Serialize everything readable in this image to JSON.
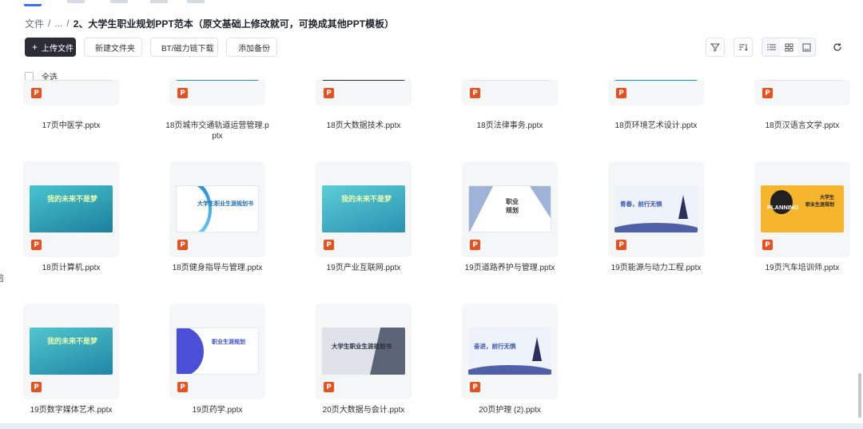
{
  "breadcrumb": {
    "root": "文件",
    "sep1": "/",
    "ellipsis": "...",
    "sep2": "/",
    "current": "2、大学生职业规划PPT范本（原文基础上修改就可，可换成其他PPT模板）"
  },
  "toolbar": {
    "upload": "上传文件",
    "new_folder": "新建文件夹",
    "bt": "BT/磁力链下载",
    "backup": "添加备份"
  },
  "select_all": "全选",
  "left_edge_char": "暗",
  "files": [
    {
      "name": "17页中医学.pptx",
      "badge": "P"
    },
    {
      "name": "18页城市交通轨道运营管理.pptx",
      "badge": "P"
    },
    {
      "name": "18页大数据技术.pptx",
      "badge": "P"
    },
    {
      "name": "18页法律事务.pptx",
      "badge": "P"
    },
    {
      "name": "18页环境艺术设计.pptx",
      "badge": "P"
    },
    {
      "name": "18页汉语言文学.pptx",
      "badge": "P"
    },
    {
      "name": "18页计算机.pptx",
      "badge": "P"
    },
    {
      "name": "18页健身指导与管理.pptx",
      "badge": "P"
    },
    {
      "name": "19页产业互联网.pptx",
      "badge": "P"
    },
    {
      "name": "19页道路养护与管理.pptx",
      "badge": "P"
    },
    {
      "name": "19页能源与动力工程.pptx",
      "badge": "P"
    },
    {
      "name": "19页汽车培训师.pptx",
      "badge": "P"
    },
    {
      "name": "19页数字媒体艺术.pptx",
      "badge": "P"
    },
    {
      "name": "19页药学.pptx",
      "badge": "P"
    },
    {
      "name": "20页大数据与会计.pptx",
      "badge": "P"
    },
    {
      "name": "20页护理 (2).pptx",
      "badge": "P"
    }
  ],
  "thumbs": {
    "t7_title": "我的未来不是梦",
    "t8_title": "大学生职业生涯规划书",
    "t9_title": "我的未来不是梦",
    "t10_title": "职业\n规划",
    "t11_title": "青春，前行无惧",
    "t12_title": "大学生\n职业生涯规划",
    "t12_word": "PLANNING",
    "t13_title": "我的未来不是梦",
    "t14_title": "职业生涯规划",
    "t15_title": "大学生职业生涯规划书",
    "t16_title": "奋进，前行无惧"
  },
  "colors": {
    "accent": "#3f6bff",
    "primary_btn": "#2b2d36",
    "ppt_badge": "#e8511f"
  }
}
